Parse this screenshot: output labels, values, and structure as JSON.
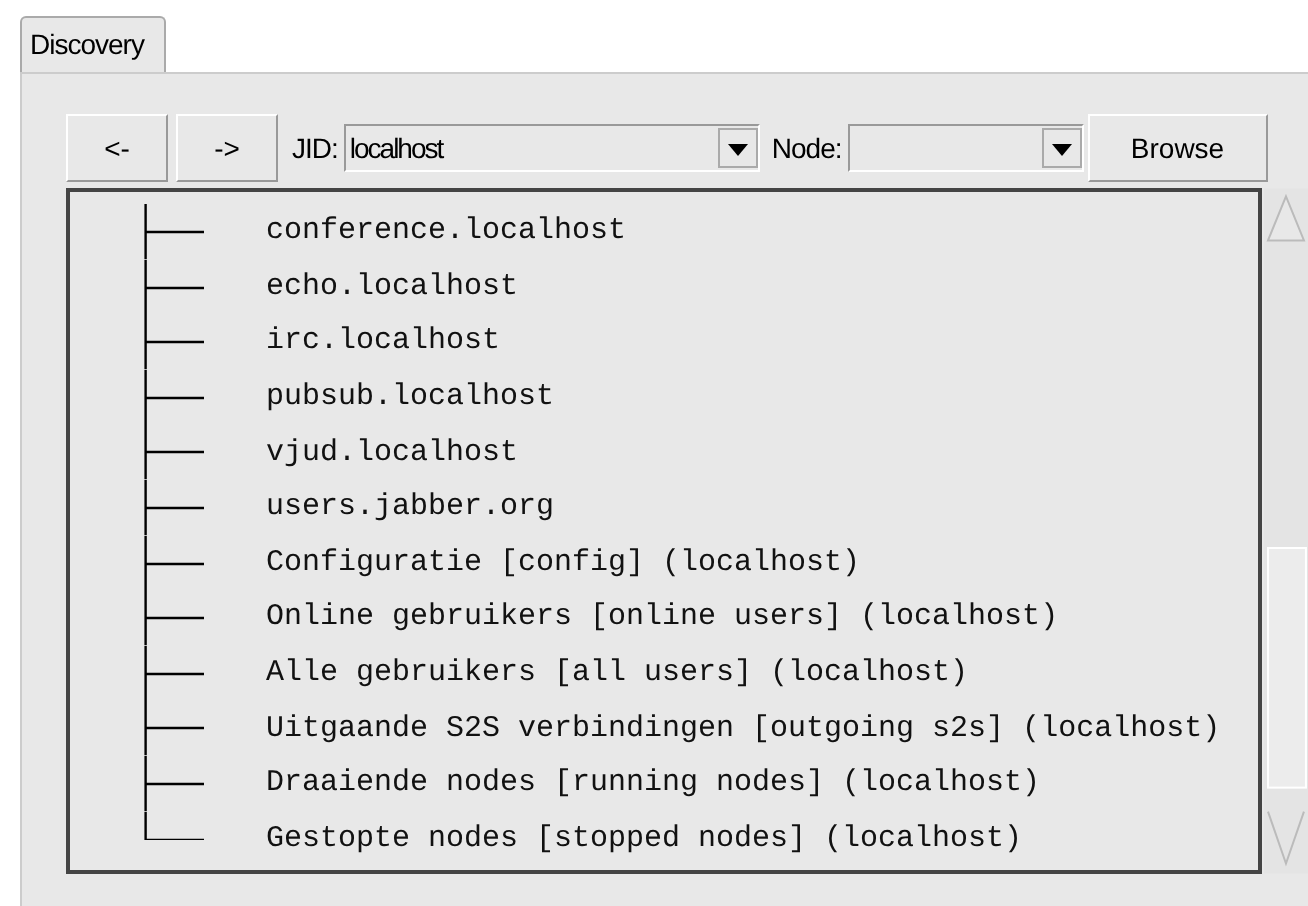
{
  "tabs": [
    {
      "label": "Discovery",
      "selected": true
    }
  ],
  "toolbar": {
    "back_button": "<-",
    "forward_button": "->",
    "jid_label": "JID:",
    "jid_value": "localhost",
    "node_label": "Node:",
    "browse_button": "Browse"
  },
  "tree": {
    "items": [
      {
        "label": "conference.localhost"
      },
      {
        "label": "echo.localhost"
      },
      {
        "label": "irc.localhost"
      },
      {
        "label": "pubsub.localhost"
      },
      {
        "label": "vjud.localhost"
      },
      {
        "label": "users.jabber.org"
      },
      {
        "label": "Configuratie [config] (localhost)"
      },
      {
        "label": "Online gebruikers [online users] (localhost)"
      },
      {
        "label": "Alle gebruikers [all users] (localhost)"
      },
      {
        "label": "Uitgaande S2S verbindingen [outgoing s2s] (localhost)"
      },
      {
        "label": "Draaiende nodes [running nodes] (localhost)"
      },
      {
        "label": "Gestopte nodes [stopped nodes] (localhost)"
      }
    ]
  }
}
